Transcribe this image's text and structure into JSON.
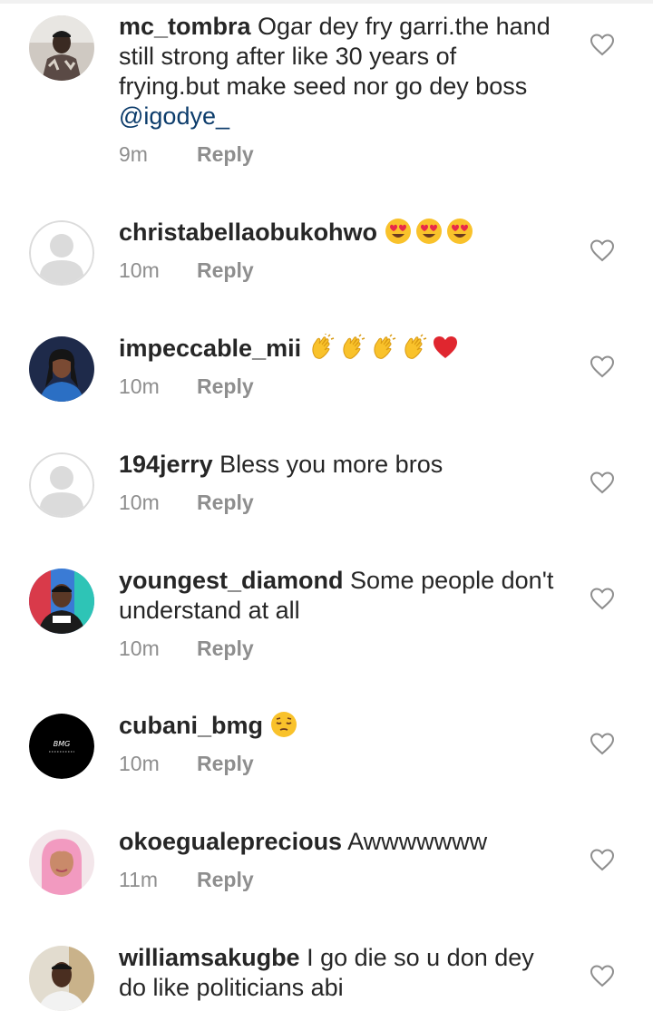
{
  "comments": [
    {
      "username": "mc_tombra",
      "text": " Ogar dey fry garri.the hand still strong after like 30 years of frying.but make seed nor go dey boss ",
      "mention": "@igodye_",
      "time": "9m",
      "reply": "Reply",
      "avatar": "photo"
    },
    {
      "username": "christabellaobukohwo",
      "text": " ",
      "emojis": [
        "heart-eyes-emoji",
        "heart-eyes-emoji",
        "heart-eyes-emoji"
      ],
      "time": "10m",
      "reply": "Reply",
      "avatar": "default"
    },
    {
      "username": "impeccable_mii",
      "text": " ",
      "emojis": [
        "clapping-hands-emoji",
        "clapping-hands-emoji",
        "clapping-hands-emoji",
        "clapping-hands-emoji",
        "red-heart-emoji"
      ],
      "time": "10m",
      "reply": "Reply",
      "avatar": "photo"
    },
    {
      "username": "194jerry",
      "text": " Bless you more bros",
      "time": "10m",
      "reply": "Reply",
      "avatar": "default"
    },
    {
      "username": "youngest_diamond",
      "text": " Some people don't understand at all",
      "time": "10m",
      "reply": "Reply",
      "avatar": "photo"
    },
    {
      "username": "cubani_bmg",
      "text": " ",
      "emojis": [
        "pensive-face-emoji"
      ],
      "time": "10m",
      "reply": "Reply",
      "avatar": "logo",
      "avatar_text": "BMG"
    },
    {
      "username": "okoegualeprecious",
      "text": " Awwwwwww",
      "time": "11m",
      "reply": "Reply",
      "avatar": "photo"
    },
    {
      "username": "williamsakugbe",
      "text": " I go die so u don dey do like politicians abi",
      "time": "",
      "reply": "",
      "avatar": "photo"
    }
  ],
  "icons": {
    "like": "heart-outline-icon",
    "default_avatar": "person-silhouette-icon"
  },
  "colors": {
    "text": "#262626",
    "meta": "#8e8e8e",
    "mention": "#0c3c6b",
    "icon": "#8e8e8e"
  }
}
